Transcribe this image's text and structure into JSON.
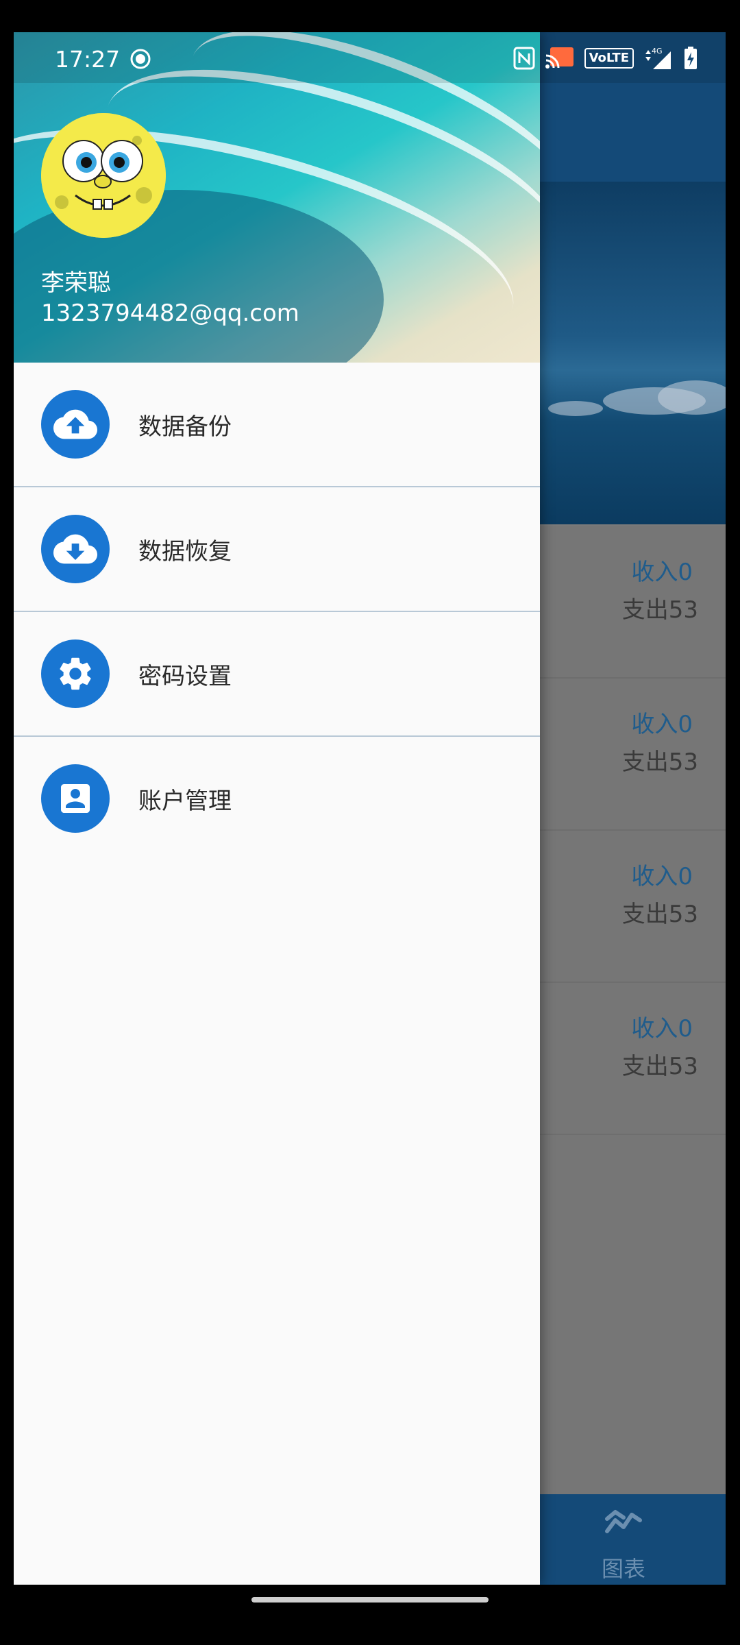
{
  "status_bar": {
    "time": "17:27",
    "volte": "VoLTE",
    "network": "4G"
  },
  "drawer": {
    "user_name": "李荣聪",
    "user_email": "1323794482@qq.com",
    "menu": [
      {
        "label": "数据备份",
        "icon": "cloud-upload-icon"
      },
      {
        "label": "数据恢复",
        "icon": "cloud-download-icon"
      },
      {
        "label": "密码设置",
        "icon": "gear-icon"
      },
      {
        "label": "账户管理",
        "icon": "account-box-icon"
      }
    ]
  },
  "background": {
    "rows": [
      {
        "income": "收入0",
        "expense": "支出53"
      },
      {
        "income": "收入0",
        "expense": "支出53"
      },
      {
        "income": "收入0",
        "expense": "支出53"
      },
      {
        "income": "收入0",
        "expense": "支出53"
      }
    ],
    "bottom_nav": {
      "chart_label": "图表"
    }
  },
  "colors": {
    "primary": "#1976d2",
    "toolbar": "#144a78",
    "drawer_bg": "#fafafa",
    "divider": "#b8c8d6"
  }
}
